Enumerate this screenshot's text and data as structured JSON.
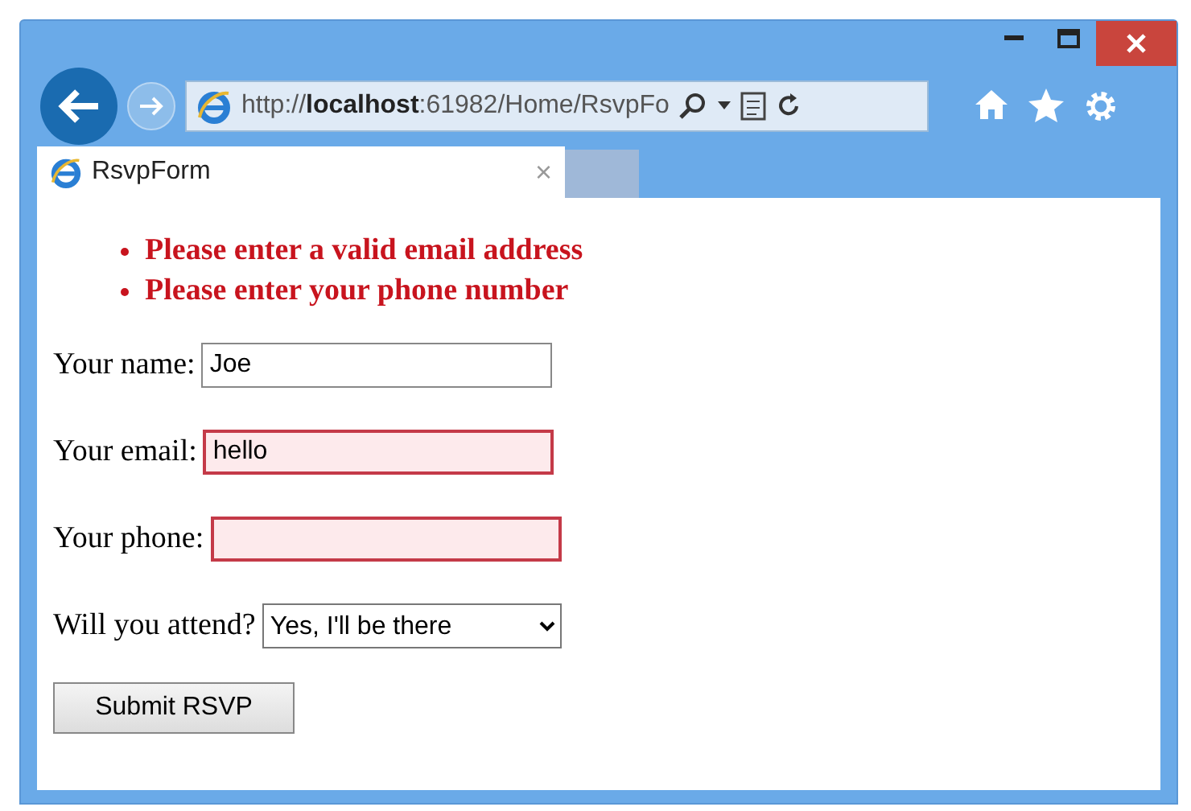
{
  "address_bar": {
    "url": "http://**localhost**:61982/Home/RsvpFo"
  },
  "tabs": [
    {
      "label": "RsvpForm",
      "close": "×",
      "selected": true
    }
  ],
  "errors": [
    "Please enter a valid email address",
    "Please enter your phone number"
  ],
  "fields": [
    {
      "label": "Your name:",
      "kind": "text",
      "value": "Joe",
      "invalid": false
    },
    {
      "label": "Your email:",
      "kind": "text",
      "value": "hello",
      "invalid": true
    },
    {
      "label": "Your phone:",
      "kind": "text",
      "invalid": true
    },
    {
      "label": "Will you attend?",
      "kind": "select",
      "value": "Yes, I'll be there",
      "invalid": false
    }
  ],
  "submit": "Submit RSVP"
}
